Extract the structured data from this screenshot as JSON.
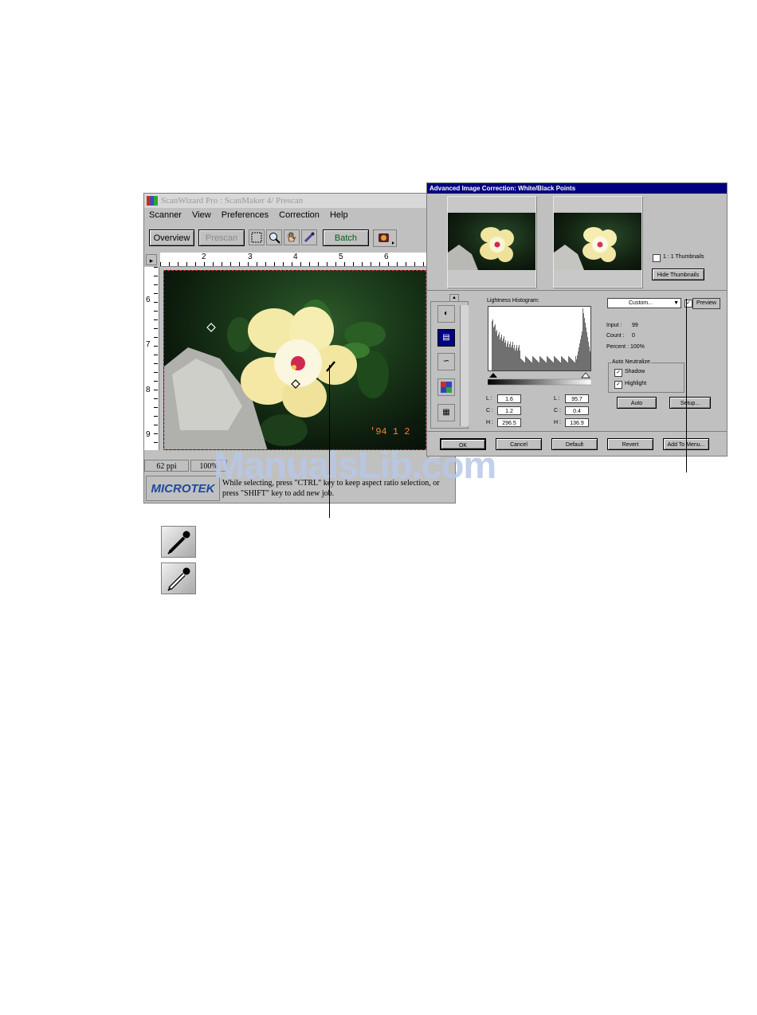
{
  "scanwizard": {
    "title": "ScanWizard Pro : ScanMaker 4/ Prescan",
    "menu": [
      "Scanner",
      "View",
      "Preferences",
      "Correction",
      "Help"
    ],
    "toolbar": {
      "overview": "Overview",
      "prescan": "Prescan",
      "batch": "Batch",
      "tools": [
        "marquee-icon",
        "magnifier-icon",
        "hand-icon",
        "eyedropper-icon"
      ]
    },
    "ruler_h": [
      "2",
      "3",
      "4",
      "5",
      "6"
    ],
    "ruler_v": [
      "6",
      "7",
      "8",
      "9"
    ],
    "photo_date_stamp": "'94  1  2",
    "status": {
      "resolution": "62 ppi",
      "zoom": "100%"
    },
    "logo_text": "MICROTEK",
    "hint": "While selecting, press \"CTRL\" key to keep aspect ratio selection, or press \"SHIFT\" key to add new job."
  },
  "aic": {
    "title": "Advanced Image Correction: White/Black Points",
    "thumbnails_label": "1 : 1 Thumbnails",
    "hide_thumbnails": "Hide Thumbnails",
    "histogram_label": "Lightness Histogram:",
    "preset": "Custom...",
    "preview": "Preview",
    "input_label": "Input :",
    "input_value": "99",
    "count_label": "Count :",
    "count_value": "0",
    "percent": "Percent : 100%",
    "auto_neutralize": "Auto Neutralize",
    "shadow": "Shadow",
    "highlight": "Highlight",
    "auto": "Auto",
    "setup": "Setup...",
    "left_fields": {
      "L": "1.6",
      "C": "1.2",
      "H": "296.5"
    },
    "right_fields": {
      "L": "95.7",
      "C": "0.4",
      "H": "136.9"
    },
    "labels": {
      "L": "L :",
      "C": "C :",
      "H": "H :"
    },
    "buttons": {
      "ok": "OK",
      "cancel": "Cancel",
      "default": "Default",
      "revert": "Revert",
      "add_to_menu": "Add To Menu..."
    }
  },
  "watermark": "ManualsLib.com"
}
